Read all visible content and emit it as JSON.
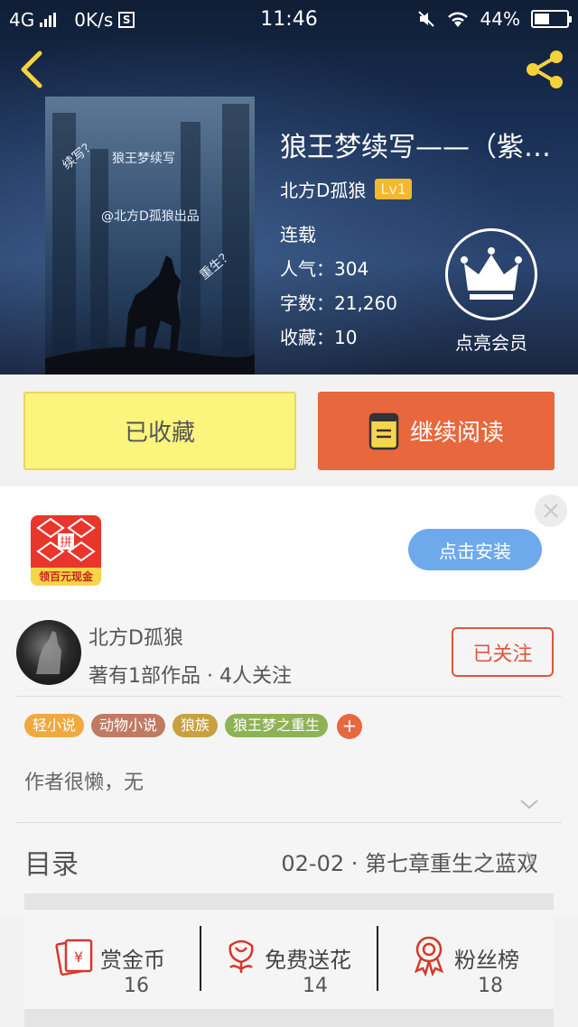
{
  "status_bar": {
    "network": "4G",
    "speed": "0K/s",
    "sim_badge": "S",
    "time": "11:46",
    "battery": "44%"
  },
  "book": {
    "title": "狼王梦续写——（紫…",
    "author": "北方D孤狼",
    "level": "Lv1",
    "status": "连载",
    "popularity_label": "人气：",
    "popularity": "304",
    "words_label": "字数：",
    "words": "21,260",
    "favorites_label": "收藏：",
    "favorites": "10",
    "vip_label": "点亮会员",
    "cover_text": {
      "title": "狼王梦续写",
      "credit": "@北方D孤狼出品",
      "left": "续写？",
      "right": "重生？"
    }
  },
  "actions": {
    "favorited_label": "已收藏",
    "continue_label": "继续阅读"
  },
  "ad": {
    "icon_caption": "领百元现金",
    "install_label": "点击安装"
  },
  "author_section": {
    "name": "北方D孤狼",
    "summary": "著有1部作品 · 4人关注",
    "follow_label": "已关注",
    "tags": [
      {
        "label": "轻小说",
        "color": "#f0a940"
      },
      {
        "label": "动物小说",
        "color": "#c07a62"
      },
      {
        "label": "狼族",
        "color": "#c9a040"
      },
      {
        "label": "狼王梦之重生",
        "color": "#8fb257"
      }
    ],
    "add_tag_label": "+",
    "intro": "作者很懒，无"
  },
  "toc": {
    "label": "目录",
    "latest": "02-02 · 第七章重生之蓝双"
  },
  "stats": [
    {
      "label": "赏金币",
      "value": "16",
      "icon": "gold-coin-envelope-icon"
    },
    {
      "label": "免费送花",
      "value": "14",
      "icon": "flower-icon"
    },
    {
      "label": "粉丝榜",
      "value": "18",
      "icon": "medal-icon"
    }
  ],
  "colors": {
    "favorite_bg": "#fbf47d",
    "continue_bg": "#e8673c",
    "install_bg": "#6ea9ec",
    "follow_accent": "#e0553d",
    "icon_red": "#d7382a"
  }
}
